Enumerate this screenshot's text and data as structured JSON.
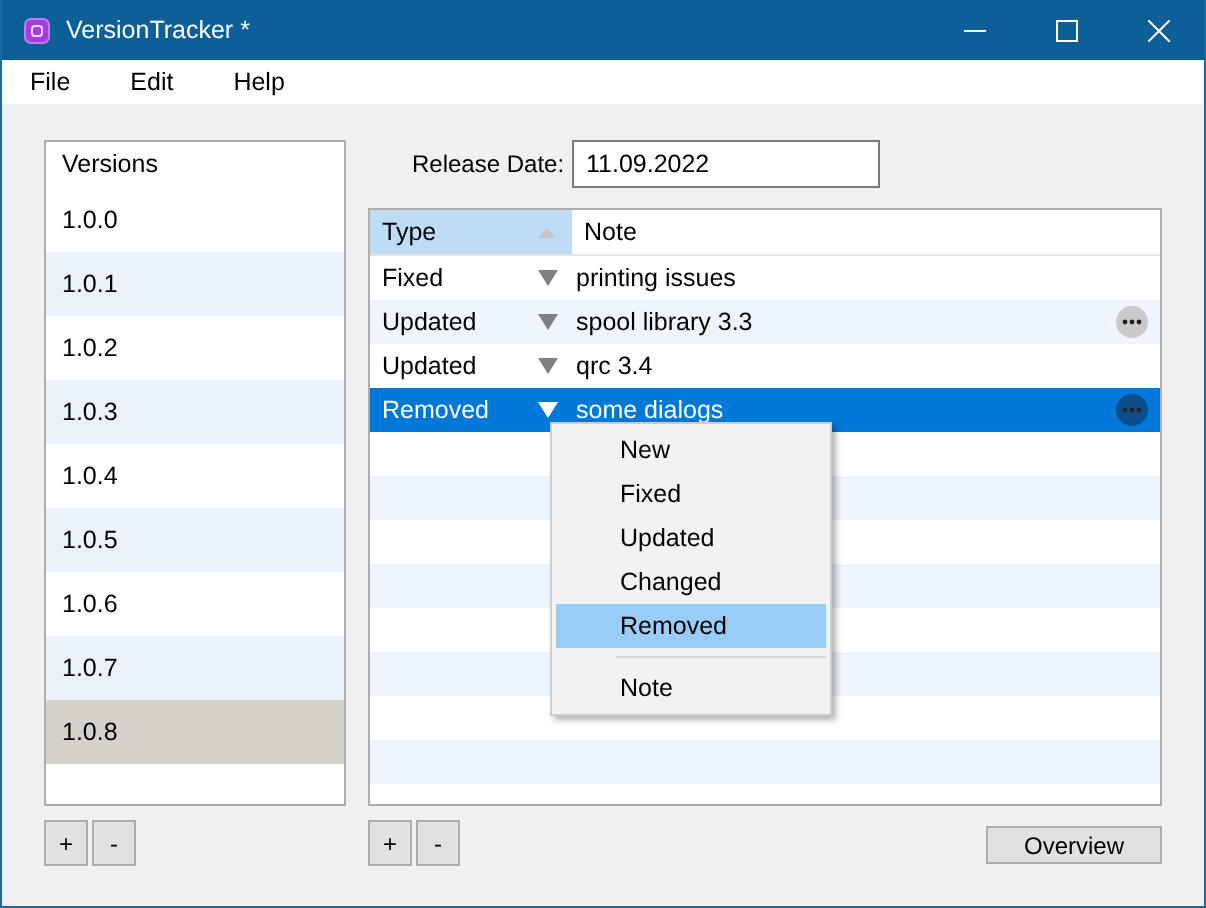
{
  "window": {
    "title": "VersionTracker *"
  },
  "menu": [
    "File",
    "Edit",
    "Help"
  ],
  "versions": {
    "header": "Versions",
    "items": [
      {
        "label": "1.0.0",
        "selected": false
      },
      {
        "label": "1.0.1",
        "selected": false
      },
      {
        "label": "1.0.2",
        "selected": false
      },
      {
        "label": "1.0.3",
        "selected": false
      },
      {
        "label": "1.0.4",
        "selected": false
      },
      {
        "label": "1.0.5",
        "selected": false
      },
      {
        "label": "1.0.6",
        "selected": false
      },
      {
        "label": "1.0.7",
        "selected": false
      },
      {
        "label": "1.0.8",
        "selected": true
      }
    ],
    "buttons": [
      "+",
      "-"
    ]
  },
  "release_date": {
    "label": "Release Date:",
    "value": "11.09.2022"
  },
  "notes_table": {
    "columns": [
      {
        "label": "Type",
        "sorted": true,
        "highlighted": true
      },
      {
        "label": "Note",
        "sorted": false,
        "highlighted": false
      }
    ],
    "rows": [
      {
        "type": "Fixed",
        "note": "printing issues",
        "selected": false,
        "more_button": false
      },
      {
        "type": "Updated",
        "note": "spool library 3.3",
        "selected": false,
        "more_button": true
      },
      {
        "type": "Updated",
        "note": "qrc 3.4",
        "selected": false,
        "more_button": false
      },
      {
        "type": "Removed",
        "note": "some dialogs",
        "selected": true,
        "more_button": true
      }
    ],
    "buttons": [
      "+",
      "-"
    ]
  },
  "context_menu": {
    "items": [
      {
        "kind": "item",
        "label": "New",
        "selected": false
      },
      {
        "kind": "item",
        "label": "Fixed",
        "selected": false
      },
      {
        "kind": "item",
        "label": "Updated",
        "selected": false
      },
      {
        "kind": "item",
        "label": "Changed",
        "selected": false
      },
      {
        "kind": "item",
        "label": "Removed",
        "selected": true
      },
      {
        "kind": "separator"
      },
      {
        "kind": "item",
        "label": "Note",
        "selected": false
      }
    ]
  },
  "overview_button": "Overview"
}
